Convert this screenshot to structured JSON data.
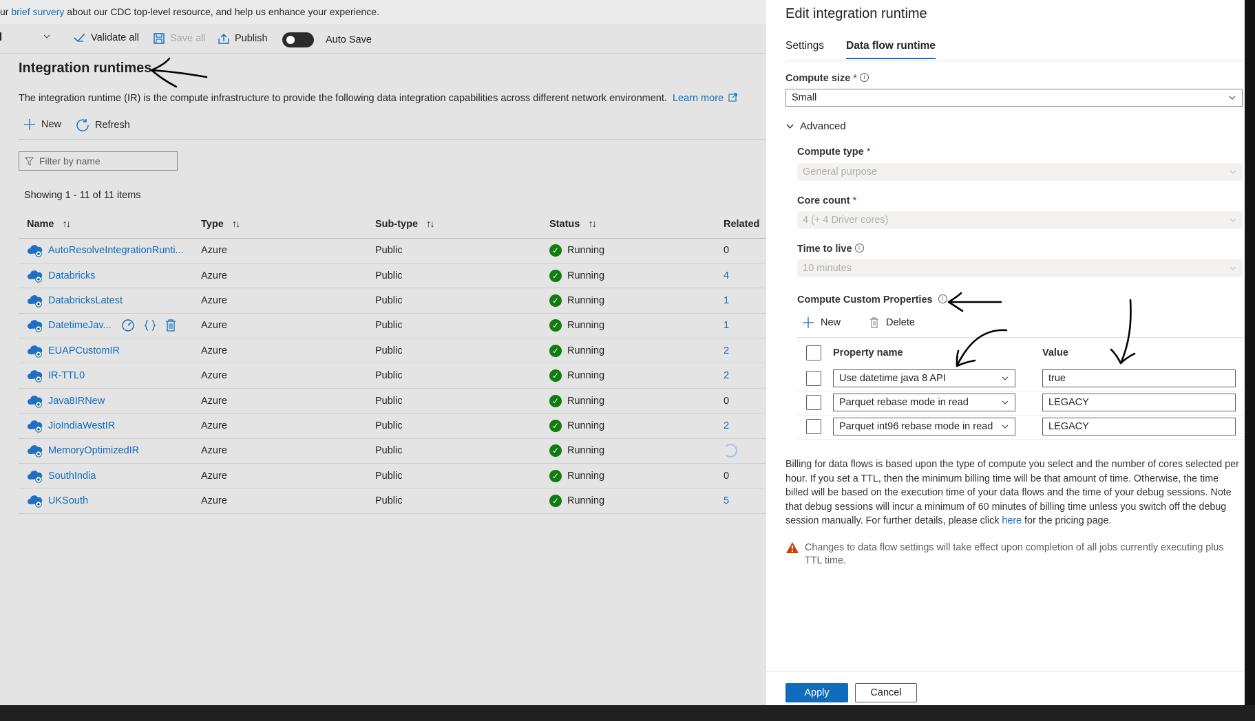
{
  "survey": {
    "prefix": "ur",
    "link": "brief survery",
    "suffix": "about our CDC top-level resource, and help us enhance your experience."
  },
  "toolbar": {
    "validate_all": "Validate all",
    "save_all": "Save all",
    "publish": "Publish",
    "auto_save": "Auto Save"
  },
  "main": {
    "title": "Integration runtimes",
    "description": "The integration runtime (IR) is the compute infrastructure to provide the following data integration capabilities across different network environment.",
    "learn_more": "Learn more",
    "new_label": "New",
    "refresh_label": "Refresh",
    "filter_placeholder": "Filter by name",
    "showing": "Showing 1 - 11 of 11 items",
    "columns": {
      "name": "Name",
      "type": "Type",
      "subtype": "Sub-type",
      "status": "Status",
      "related": "Related"
    },
    "rows": [
      {
        "name": "AutoResolveIntegrationRunti...",
        "type": "Azure",
        "subtype": "Public",
        "status": "Running",
        "related": "0"
      },
      {
        "name": "Databricks",
        "type": "Azure",
        "subtype": "Public",
        "status": "Running",
        "related": "4"
      },
      {
        "name": "DatabricksLatest",
        "type": "Azure",
        "subtype": "Public",
        "status": "Running",
        "related": "1"
      },
      {
        "name": "DatetimeJav...",
        "type": "Azure",
        "subtype": "Public",
        "status": "Running",
        "related": "1"
      },
      {
        "name": "EUAPCustomIR",
        "type": "Azure",
        "subtype": "Public",
        "status": "Running",
        "related": "2"
      },
      {
        "name": "IR-TTL0",
        "type": "Azure",
        "subtype": "Public",
        "status": "Running",
        "related": "2"
      },
      {
        "name": "Java8IRNew",
        "type": "Azure",
        "subtype": "Public",
        "status": "Running",
        "related": "0"
      },
      {
        "name": "JioIndiaWestIR",
        "type": "Azure",
        "subtype": "Public",
        "status": "Running",
        "related": "2"
      },
      {
        "name": "MemoryOptimizedIR",
        "type": "Azure",
        "subtype": "Public",
        "status": "Running",
        "related": ""
      },
      {
        "name": "SouthIndia",
        "type": "Azure",
        "subtype": "Public",
        "status": "Running",
        "related": "0"
      },
      {
        "name": "UKSouth",
        "type": "Azure",
        "subtype": "Public",
        "status": "Running",
        "related": "5"
      }
    ]
  },
  "panel": {
    "title": "Edit integration runtime",
    "tabs": [
      {
        "label": "Settings"
      },
      {
        "label": "Data flow runtime"
      }
    ],
    "compute_size_label": "Compute size",
    "compute_size_value": "Small",
    "advanced_label": "Advanced",
    "compute_type_label": "Compute type",
    "compute_type_value": "General purpose",
    "core_count_label": "Core count",
    "core_count_value": "4 (+ 4 Driver cores)",
    "ttl_label": "Time to live",
    "ttl_value": "10 minutes",
    "custom_props_label": "Compute Custom Properties",
    "new_label": "New",
    "delete_label": "Delete",
    "col_property": "Property name",
    "col_value": "Value",
    "props": [
      {
        "name": "Use datetime java 8 API",
        "value": "true"
      },
      {
        "name": "Parquet rebase mode in read",
        "value": "LEGACY"
      },
      {
        "name": "Parquet int96 rebase mode in read",
        "value": "LEGACY"
      }
    ],
    "billing_text": "Billing for data flows is based upon the type of compute you select and the number of cores selected per hour. If you set a TTL, then the minimum billing time will be that amount of time. Otherwise, the time billed will be based on the execution time of your data flows and the time of your debug sessions. Note that debug sessions will incur a minimum of 60 minutes of billing time unless you switch off the debug session manually. For further details, please click",
    "billing_link": "here",
    "billing_suffix": "for the pricing page.",
    "warning_text": "Changes to data flow settings will take effect upon completion of all jobs currently executing plus TTL time.",
    "apply": "Apply",
    "cancel": "Cancel"
  },
  "colors": {
    "accent": "#0f6cbd",
    "success": "#107c10",
    "warning": "#d83b01"
  }
}
